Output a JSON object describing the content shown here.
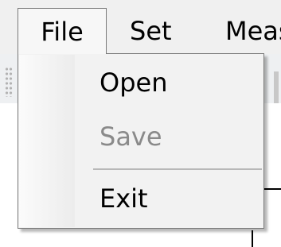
{
  "menubar": {
    "items": [
      {
        "label": "File"
      },
      {
        "label": "Set"
      },
      {
        "label": "Meas"
      }
    ]
  },
  "file_menu": {
    "items": [
      {
        "label": "Open",
        "enabled": true
      },
      {
        "label": "Save",
        "enabled": false
      },
      {
        "label": "Exit",
        "enabled": true
      }
    ]
  },
  "colors": {
    "menu_background": "#f2f2f2",
    "menu_border": "#7a7a7a",
    "disabled_text": "#8a8a8a",
    "text": "#000000"
  }
}
